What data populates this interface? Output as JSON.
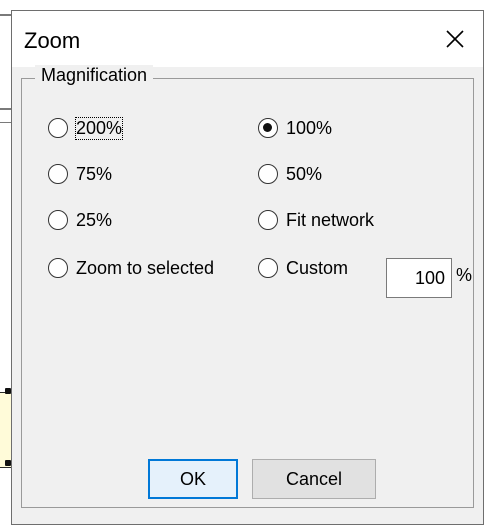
{
  "dialog": {
    "title": "Zoom",
    "close_icon": "close-icon"
  },
  "magnification": {
    "legend": "Magnification",
    "options": [
      {
        "label": "200%",
        "checked": false,
        "focused": true
      },
      {
        "label": "100%",
        "checked": true,
        "focused": false
      },
      {
        "label": "75%",
        "checked": false,
        "focused": false
      },
      {
        "label": "50%",
        "checked": false,
        "focused": false
      },
      {
        "label": "25%",
        "checked": false,
        "focused": false
      },
      {
        "label": "Fit network",
        "checked": false,
        "focused": false
      },
      {
        "label": "Zoom to selected",
        "checked": false,
        "focused": false
      },
      {
        "label": "Custom",
        "checked": false,
        "focused": false
      }
    ],
    "custom_value": "100",
    "custom_unit": "%"
  },
  "buttons": {
    "ok": "OK",
    "cancel": "Cancel"
  },
  "colors": {
    "dialog_bg": "#f0f0f0",
    "ok_border": "#0078d7"
  }
}
